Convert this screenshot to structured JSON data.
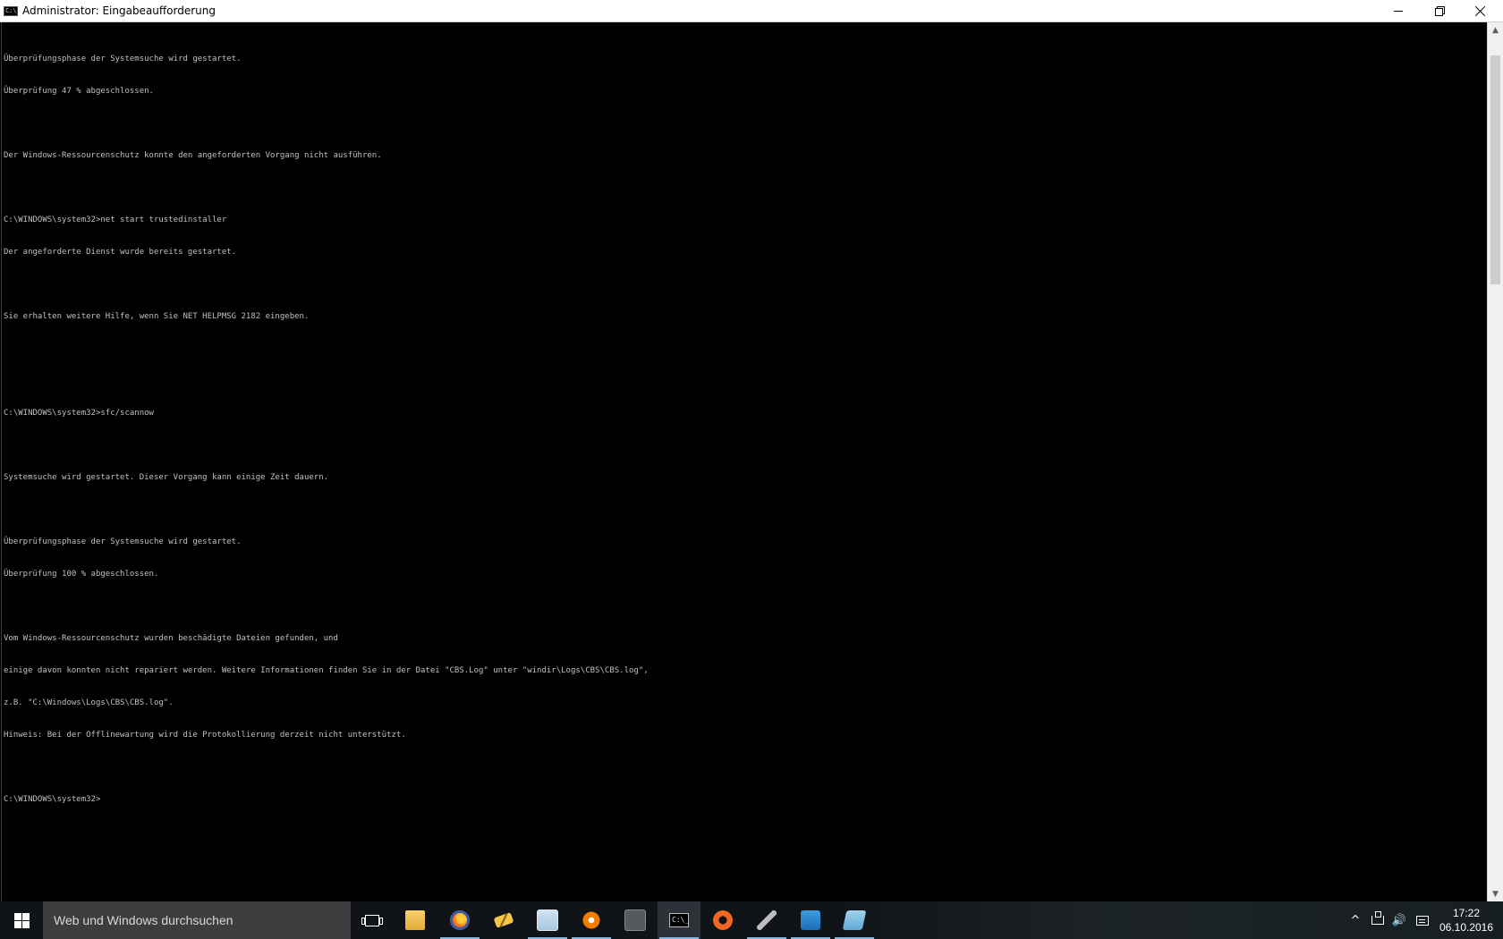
{
  "window": {
    "title": "Administrator: Eingabeaufforderung",
    "icon_text": "C:\\",
    "controls": [
      "minimize-icon",
      "restore-icon",
      "close-icon"
    ]
  },
  "console": {
    "lines": [
      "Überprüfungsphase der Systemsuche wird gestartet.",
      "Überprüfung 47 % abgeschlossen.",
      "",
      "Der Windows-Ressourcenschutz konnte den angeforderten Vorgang nicht ausführen.",
      "",
      "C:\\WINDOWS\\system32>net start trustedinstaller",
      "Der angeforderte Dienst wurde bereits gestartet.",
      "",
      "Sie erhalten weitere Hilfe, wenn Sie NET HELPMSG 2182 eingeben.",
      "",
      "",
      "C:\\WINDOWS\\system32>sfc/scannow",
      "",
      "Systemsuche wird gestartet. Dieser Vorgang kann einige Zeit dauern.",
      "",
      "Überprüfungsphase der Systemsuche wird gestartet.",
      "Überprüfung 100 % abgeschlossen.",
      "",
      "Vom Windows-Ressourcenschutz wurden beschädigte Dateien gefunden, und",
      "einige davon konnten nicht repariert werden. Weitere Informationen finden Sie in der Datei \"CBS.Log\" unter \"windir\\Logs\\CBS\\CBS.log\",",
      "z.B. \"C:\\Windows\\Logs\\CBS\\CBS.log\".",
      "Hinweis: Bei der Offlinewartung wird die Protokollierung derzeit nicht unterstützt.",
      "",
      "C:\\WINDOWS\\system32>"
    ]
  },
  "scrollbar": {
    "up_arrow": "▲",
    "down_arrow": "▼"
  },
  "taskbar": {
    "search_placeholder": "Web und Windows durchsuchen",
    "cmd_icon_text": "C:\\_",
    "pinned_apps": [
      {
        "name": "file-explorer-icon"
      },
      {
        "name": "firefox-icon"
      },
      {
        "name": "pen-icon"
      },
      {
        "name": "notepad-icon"
      },
      {
        "name": "avast-icon"
      },
      {
        "name": "nvidia-icon"
      },
      {
        "name": "command-prompt-icon",
        "active": true
      },
      {
        "name": "origin-icon"
      },
      {
        "name": "usb-icon"
      },
      {
        "name": "outlook-icon"
      },
      {
        "name": "tablet-icon"
      }
    ],
    "tray": {
      "chevron": "^",
      "volume": "🔊",
      "time": "17:22",
      "date": "06.10.2016"
    }
  }
}
